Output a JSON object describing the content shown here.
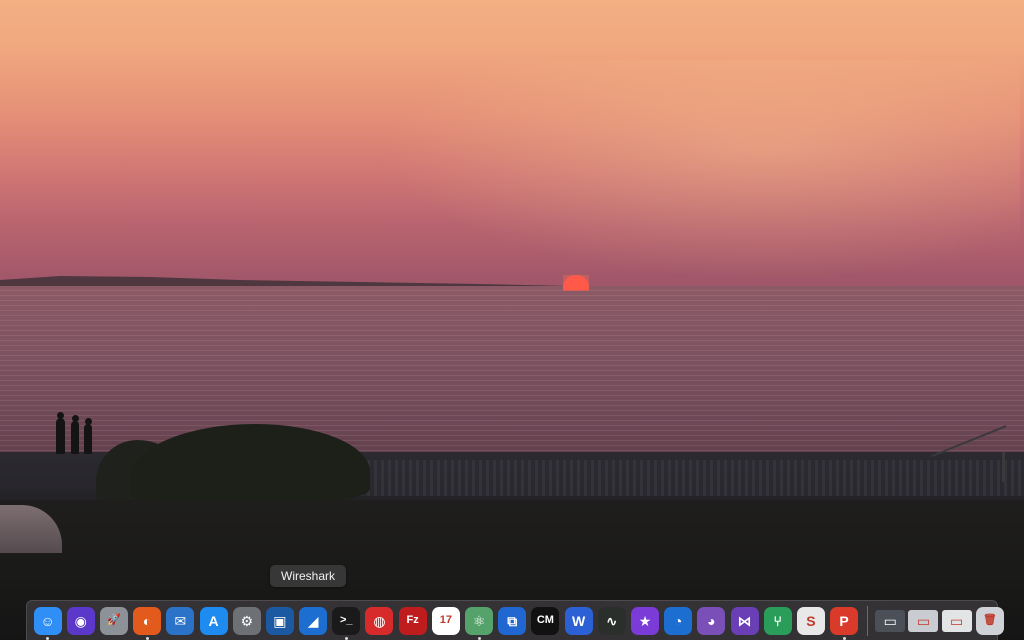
{
  "tooltip": {
    "label": "Wireshark",
    "for": "wireshark"
  },
  "dock": {
    "apps": [
      {
        "id": "finder",
        "name": "Finder",
        "icon": "finder-icon",
        "glyph": "☺",
        "color": "#2f8ff6",
        "running": true
      },
      {
        "id": "siri",
        "name": "Siri",
        "icon": "siri-icon",
        "glyph": "◉",
        "color": "#5b38c9",
        "running": false
      },
      {
        "id": "launchpad",
        "name": "Launchpad",
        "icon": "rocket-icon",
        "glyph": "🚀",
        "color": "#8d9198",
        "running": false
      },
      {
        "id": "firefox",
        "name": "Firefox",
        "icon": "firefox-icon",
        "glyph": "◐",
        "color": "#e25a1c",
        "running": true
      },
      {
        "id": "thunderbird",
        "name": "Thunderbird",
        "icon": "thunderbird-icon",
        "glyph": "✉",
        "color": "#2a73c9",
        "running": false
      },
      {
        "id": "app-store",
        "name": "App Store",
        "icon": "app-store-icon",
        "glyph": "A",
        "color": "#1e8bf0",
        "running": false
      },
      {
        "id": "system-preferences",
        "name": "System Preferences",
        "icon": "gear-icon",
        "glyph": "⚙",
        "color": "#6d7075",
        "running": false
      },
      {
        "id": "virtualbox",
        "name": "VirtualBox",
        "icon": "virtualbox-icon",
        "glyph": "▣",
        "color": "#1b5aa3",
        "running": false
      },
      {
        "id": "wireshark",
        "name": "Wireshark",
        "icon": "shark-fin-icon",
        "glyph": "◢",
        "color": "#1c6fd1",
        "running": false
      },
      {
        "id": "terminal",
        "name": "Terminal",
        "icon": "terminal-icon",
        "glyph": ">_",
        "color": "#1a1a1a",
        "running": true
      },
      {
        "id": "vpn",
        "name": "VPN",
        "icon": "globe-icon",
        "glyph": "◍",
        "color": "#d72b2b",
        "running": false
      },
      {
        "id": "filezilla",
        "name": "FileZilla",
        "icon": "filezilla-icon",
        "glyph": "Fz",
        "color": "#bf1d1d",
        "running": false
      },
      {
        "id": "calendar",
        "name": "Calendar",
        "icon": "calendar-icon",
        "glyph": "17",
        "color": "#ffffff",
        "running": false
      },
      {
        "id": "atom",
        "name": "Atom",
        "icon": "atom-icon",
        "glyph": "⚛",
        "color": "#55a36b",
        "running": true
      },
      {
        "id": "teamviewer",
        "name": "TeamViewer",
        "icon": "overlap-squares-icon",
        "glyph": "⧉",
        "color": "#2167d1",
        "running": false
      },
      {
        "id": "cm",
        "name": "CM",
        "icon": "cm-icon",
        "glyph": "CM",
        "color": "#111111",
        "running": false
      },
      {
        "id": "word",
        "name": "Word",
        "icon": "word-icon",
        "glyph": "W",
        "color": "#2b61d4",
        "running": false
      },
      {
        "id": "activity-monitor",
        "name": "Activity Monitor",
        "icon": "activity-monitor-icon",
        "glyph": "∿",
        "color": "#2b2f2b",
        "running": false
      },
      {
        "id": "imovie",
        "name": "iMovie",
        "icon": "star-icon",
        "glyph": "★",
        "color": "#7a3bd6",
        "running": false
      },
      {
        "id": "safari-tech",
        "name": "Browser",
        "icon": "compass-icon",
        "glyph": "◔",
        "color": "#1c6fd1",
        "running": false
      },
      {
        "id": "github",
        "name": "GitHub Desktop",
        "icon": "github-cat-icon",
        "glyph": "◕",
        "color": "#7b4fb8",
        "running": false
      },
      {
        "id": "visual-studio",
        "name": "Visual Studio",
        "icon": "visual-studio-icon",
        "glyph": "⋈",
        "color": "#6a3fb5",
        "running": false
      },
      {
        "id": "sourcetree",
        "name": "Sourcetree",
        "icon": "tree-icon",
        "glyph": "⑂",
        "color": "#2b9d5b",
        "running": false
      },
      {
        "id": "slack",
        "name": "Slack",
        "icon": "slack-icon",
        "glyph": "S",
        "color": "#e8e8e8",
        "running": false
      },
      {
        "id": "wps",
        "name": "Presentation",
        "icon": "p-icon",
        "glyph": "P",
        "color": "#d93a2a",
        "running": true
      }
    ],
    "others": [
      {
        "id": "doc-1",
        "name": "Document 1",
        "icon": "document-thumbnail-icon",
        "glyph": "▭",
        "color": "#4a4f58",
        "running": false
      },
      {
        "id": "doc-2",
        "name": "Document 2",
        "icon": "document-thumbnail-icon",
        "glyph": "▭",
        "color": "#c9ccd1",
        "running": false
      },
      {
        "id": "doc-3",
        "name": "Document 3",
        "icon": "document-thumbnail-icon",
        "glyph": "▭",
        "color": "#e3e4e6",
        "running": false
      },
      {
        "id": "trash",
        "name": "Trash",
        "icon": "trash-icon",
        "glyph": "🗑",
        "color": "#cfd2d6",
        "running": false
      }
    ]
  }
}
